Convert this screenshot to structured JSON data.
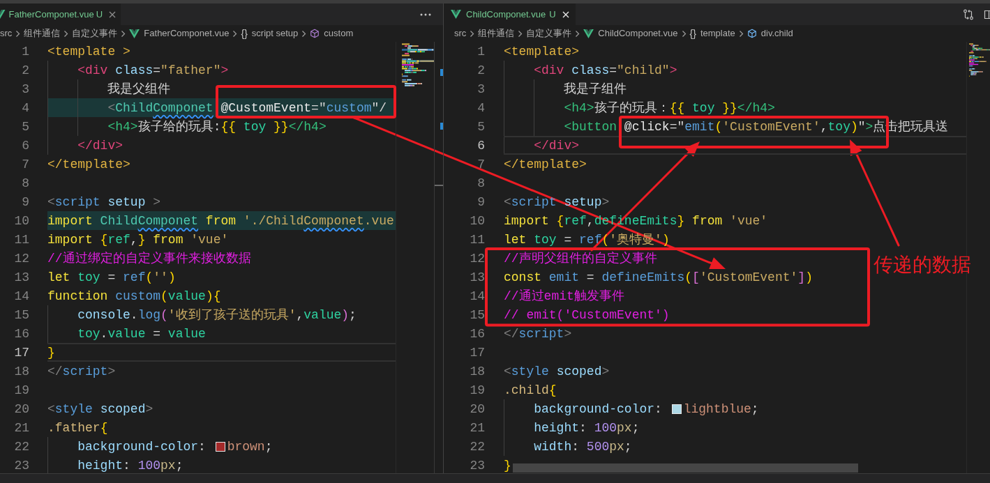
{
  "editors": [
    {
      "focused": false,
      "tab": {
        "label": "FatherComponet.vue",
        "badge": "U",
        "selected": true
      },
      "actions": [
        {
          "kind": "more"
        }
      ],
      "breadcrumb": [
        {
          "kind": "folder",
          "label": "src"
        },
        {
          "kind": "folder",
          "label": "组件通信"
        },
        {
          "kind": "folder",
          "label": "自定义事件"
        },
        {
          "kind": "file",
          "label": "FatherComponet.vue"
        },
        {
          "kind": "object",
          "glyph": "{}",
          "label": "script setup"
        },
        {
          "kind": "function",
          "label": "custom"
        }
      ],
      "lines": [
        {
          "number": "1",
          "current": false,
          "highlighted": false,
          "tokens": [
            {
              "text": "<template >",
              "kind": "tpl"
            }
          ]
        },
        {
          "number": "2",
          "current": false,
          "highlighted": false,
          "tokens": [
            {
              "text": "    <div",
              "kind": "tag"
            },
            {
              "text": " class",
              "kind": "attr"
            },
            {
              "text": "=",
              "kind": "op"
            },
            {
              "text": "\"father\"",
              "kind": "str"
            },
            {
              "text": ">",
              "kind": "tag"
            }
          ]
        },
        {
          "number": "3",
          "current": false,
          "highlighted": false,
          "tokens": [
            {
              "text": "        我是父组件",
              "kind": "txt"
            }
          ]
        },
        {
          "number": "4",
          "current": false,
          "highlighted": true,
          "tokens": [
            {
              "text": "        <",
              "kind": "gt"
            },
            {
              "text": "Child",
              "kind": "cls"
            },
            {
              "text": "Componet",
              "kind": "cls",
              "misspelled": true
            },
            {
              "text": " @CustomEvent",
              "kind": "at"
            },
            {
              "text": "=\"",
              "kind": "op"
            },
            {
              "text": "custom",
              "kind": "fn"
            },
            {
              "text": "\"/",
              "kind": "op"
            }
          ]
        },
        {
          "number": "5",
          "current": false,
          "highlighted": false,
          "tokens": [
            {
              "text": "        <h4>",
              "kind": "h4"
            },
            {
              "text": "孩子给的玩具:",
              "kind": "txt"
            },
            {
              "text": "{{",
              "kind": "b1"
            },
            {
              "text": " toy ",
              "kind": "var"
            },
            {
              "text": "}}",
              "kind": "b1"
            },
            {
              "text": "</h4>",
              "kind": "h4"
            }
          ]
        },
        {
          "number": "6",
          "current": false,
          "highlighted": false,
          "tokens": [
            {
              "text": "    </div>",
              "kind": "tag"
            }
          ]
        },
        {
          "number": "7",
          "current": false,
          "highlighted": false,
          "tokens": [
            {
              "text": "</template>",
              "kind": "tpl"
            }
          ]
        },
        {
          "number": "8",
          "current": false,
          "highlighted": false
        },
        {
          "number": "9",
          "current": false,
          "highlighted": false,
          "tokens": [
            {
              "text": "<",
              "kind": "gt"
            },
            {
              "text": "script",
              "kind": "fn"
            },
            {
              "text": " setup",
              "kind": "attr"
            },
            {
              "text": " >",
              "kind": "gt"
            }
          ]
        },
        {
          "number": "10",
          "current": false,
          "highlighted": true,
          "tokens": [
            {
              "text": "import",
              "kind": "kw"
            },
            {
              "text": " Child",
              "kind": "cls"
            },
            {
              "text": "Componet",
              "kind": "cls",
              "misspelled": true
            },
            {
              "text": " from",
              "kind": "kw"
            },
            {
              "text": " './Child",
              "kind": "str"
            },
            {
              "text": "Componet",
              "kind": "str",
              "misspelled": true
            },
            {
              "text": ".vue",
              "kind": "str"
            }
          ]
        },
        {
          "number": "11",
          "current": false,
          "highlighted": false,
          "tokens": [
            {
              "text": "import",
              "kind": "kw"
            },
            {
              "text": " {",
              "kind": "b1"
            },
            {
              "text": "ref",
              "kind": "var"
            },
            {
              "text": ",",
              "kind": "op"
            },
            {
              "text": "}",
              "kind": "b1"
            },
            {
              "text": " from",
              "kind": "kw"
            },
            {
              "text": " 'vue'",
              "kind": "str"
            }
          ]
        },
        {
          "number": "12",
          "current": false,
          "highlighted": false,
          "tokens": [
            {
              "text": "//通过绑定的自定义事件来接收数据",
              "kind": "cmt"
            }
          ]
        },
        {
          "number": "13",
          "current": false,
          "highlighted": false,
          "tokens": [
            {
              "text": "let",
              "kind": "kw"
            },
            {
              "text": " toy",
              "kind": "var"
            },
            {
              "text": " =",
              "kind": "op"
            },
            {
              "text": " ref",
              "kind": "fn"
            },
            {
              "text": "(",
              "kind": "b1"
            },
            {
              "text": "''",
              "kind": "str"
            },
            {
              "text": ")",
              "kind": "b1"
            }
          ]
        },
        {
          "number": "14",
          "current": false,
          "highlighted": false,
          "tokens": [
            {
              "text": "function",
              "kind": "kw"
            },
            {
              "text": " custom",
              "kind": "fn"
            },
            {
              "text": "(",
              "kind": "b1"
            },
            {
              "text": "value",
              "kind": "var"
            },
            {
              "text": ")",
              "kind": "b1"
            },
            {
              "text": "{",
              "kind": "b1"
            }
          ]
        },
        {
          "number": "15",
          "current": false,
          "highlighted": false,
          "tokens": [
            {
              "text": "    console",
              "kind": "attr"
            },
            {
              "text": ".",
              "kind": "op"
            },
            {
              "text": "log",
              "kind": "fn"
            },
            {
              "text": "(",
              "kind": "b2"
            },
            {
              "text": "'收到了孩子送的玩具'",
              "kind": "str"
            },
            {
              "text": ",",
              "kind": "op"
            },
            {
              "text": "value",
              "kind": "var"
            },
            {
              "text": ")",
              "kind": "b2"
            },
            {
              "text": ";",
              "kind": "op"
            }
          ]
        },
        {
          "number": "16",
          "current": false,
          "highlighted": false,
          "tokens": [
            {
              "text": "    toy",
              "kind": "var"
            },
            {
              "text": ".",
              "kind": "op"
            },
            {
              "text": "value",
              "kind": "var"
            },
            {
              "text": " =",
              "kind": "op"
            },
            {
              "text": " value",
              "kind": "var"
            }
          ]
        },
        {
          "number": "17",
          "current": true,
          "highlighted": false,
          "tokens": [
            {
              "text": "}",
              "kind": "b1"
            }
          ]
        },
        {
          "number": "18",
          "current": false,
          "highlighted": false,
          "tokens": [
            {
              "text": "</",
              "kind": "gt"
            },
            {
              "text": "script",
              "kind": "fn"
            },
            {
              "text": ">",
              "kind": "gt"
            }
          ]
        },
        {
          "number": "19",
          "current": false,
          "highlighted": false
        },
        {
          "number": "20",
          "current": false,
          "highlighted": false,
          "tokens": [
            {
              "text": "<",
              "kind": "gt"
            },
            {
              "text": "style",
              "kind": "fn"
            },
            {
              "text": " scoped",
              "kind": "attr"
            },
            {
              "text": ">",
              "kind": "gt"
            }
          ]
        },
        {
          "number": "21",
          "current": false,
          "highlighted": false,
          "tokens": [
            {
              "text": ".father",
              "kind": "sel"
            },
            {
              "text": "{",
              "kind": "b1"
            }
          ]
        },
        {
          "number": "22",
          "current": false,
          "highlighted": false,
          "tokens": [
            {
              "text": "    background-color",
              "kind": "attr"
            },
            {
              "text": ": ",
              "kind": "op"
            },
            {
              "kind": "swatch",
              "color": "#a52a2a"
            },
            {
              "text": "brown",
              "kind": "val"
            },
            {
              "text": ";",
              "kind": "op"
            }
          ]
        },
        {
          "number": "23",
          "current": false,
          "highlighted": false,
          "tokens": [
            {
              "text": "    height",
              "kind": "attr"
            },
            {
              "text": ": ",
              "kind": "op"
            },
            {
              "text": "100",
              "kind": "num"
            },
            {
              "text": "px",
              "kind": "unit"
            },
            {
              "text": ";",
              "kind": "op"
            }
          ]
        }
      ]
    },
    {
      "focused": true,
      "tab": {
        "label": "ChildComponet.vue",
        "badge": "U",
        "selected": true
      },
      "actions": [
        {
          "kind": "compare"
        },
        {
          "kind": "split"
        }
      ],
      "breadcrumb": [
        {
          "kind": "folder",
          "label": "src"
        },
        {
          "kind": "folder",
          "label": "组件通信"
        },
        {
          "kind": "folder",
          "label": "自定义事件"
        },
        {
          "kind": "file",
          "label": "ChildComponet.vue"
        },
        {
          "kind": "object",
          "glyph": "{}",
          "label": "template"
        },
        {
          "kind": "element",
          "label": "div.child"
        }
      ],
      "lines": [
        {
          "number": "1",
          "current": false,
          "highlighted": false,
          "tokens": [
            {
              "text": "<template>",
              "kind": "tpl"
            }
          ]
        },
        {
          "number": "2",
          "current": false,
          "highlighted": false,
          "tokens": [
            {
              "text": "    <div",
              "kind": "tag"
            },
            {
              "text": " class",
              "kind": "attr"
            },
            {
              "text": "=",
              "kind": "op"
            },
            {
              "text": "\"child\"",
              "kind": "str"
            },
            {
              "text": ">",
              "kind": "tag"
            }
          ]
        },
        {
          "number": "3",
          "current": false,
          "highlighted": false,
          "tokens": [
            {
              "text": "        我是子组件",
              "kind": "txt"
            }
          ]
        },
        {
          "number": "4",
          "current": false,
          "highlighted": false,
          "tokens": [
            {
              "text": "        <h4>",
              "kind": "h4"
            },
            {
              "text": "孩子的玩具：",
              "kind": "txt"
            },
            {
              "text": "{{",
              "kind": "b1"
            },
            {
              "text": " toy ",
              "kind": "var"
            },
            {
              "text": "}}",
              "kind": "b1"
            },
            {
              "text": "</h4>",
              "kind": "h4"
            }
          ]
        },
        {
          "number": "5",
          "current": false,
          "highlighted": false,
          "tokens": [
            {
              "text": "        <button",
              "kind": "h4"
            },
            {
              "text": " @click",
              "kind": "at"
            },
            {
              "text": "=\"",
              "kind": "op"
            },
            {
              "text": "emit",
              "kind": "fn"
            },
            {
              "text": "(",
              "kind": "b1"
            },
            {
              "text": "'CustomEvent'",
              "kind": "str"
            },
            {
              "text": ",",
              "kind": "op"
            },
            {
              "text": "toy",
              "kind": "var"
            },
            {
              "text": ")",
              "kind": "b1"
            },
            {
              "text": "\"",
              "kind": "op"
            },
            {
              "text": ">",
              "kind": "h4"
            },
            {
              "text": "点击把玩具送",
              "kind": "txt"
            }
          ]
        },
        {
          "number": "6",
          "current": true,
          "highlighted": false,
          "tokens": [
            {
              "text": "    </div>",
              "kind": "tag"
            }
          ]
        },
        {
          "number": "7",
          "current": false,
          "highlighted": false,
          "tokens": [
            {
              "text": "</template>",
              "kind": "tpl"
            }
          ]
        },
        {
          "number": "8",
          "current": false,
          "highlighted": false
        },
        {
          "number": "9",
          "current": false,
          "highlighted": false,
          "tokens": [
            {
              "text": "<",
              "kind": "gt"
            },
            {
              "text": "script",
              "kind": "fn"
            },
            {
              "text": " setup",
              "kind": "attr"
            },
            {
              "text": ">",
              "kind": "gt"
            }
          ]
        },
        {
          "number": "10",
          "current": false,
          "highlighted": false,
          "tokens": [
            {
              "text": "import",
              "kind": "kw"
            },
            {
              "text": " {",
              "kind": "b1"
            },
            {
              "text": "ref",
              "kind": "var"
            },
            {
              "text": ",",
              "kind": "op"
            },
            {
              "text": "defineEmits",
              "kind": "var"
            },
            {
              "text": "}",
              "kind": "b1"
            },
            {
              "text": " from",
              "kind": "kw"
            },
            {
              "text": " 'vue'",
              "kind": "str"
            }
          ]
        },
        {
          "number": "11",
          "current": false,
          "highlighted": false,
          "tokens": [
            {
              "text": "let",
              "kind": "kw"
            },
            {
              "text": " toy",
              "kind": "var"
            },
            {
              "text": " =",
              "kind": "op"
            },
            {
              "text": " ref",
              "kind": "fn"
            },
            {
              "text": "(",
              "kind": "b1"
            },
            {
              "text": "'奥特曼'",
              "kind": "str"
            },
            {
              "text": ")",
              "kind": "b1"
            }
          ]
        },
        {
          "number": "12",
          "current": false,
          "highlighted": false,
          "tokens": [
            {
              "text": "//声明父组件的自定义事件",
              "kind": "cmt"
            }
          ]
        },
        {
          "number": "13",
          "current": false,
          "highlighted": false,
          "tokens": [
            {
              "text": "const",
              "kind": "kw"
            },
            {
              "text": " emit",
              "kind": "fn"
            },
            {
              "text": " =",
              "kind": "op"
            },
            {
              "text": " defineEmits",
              "kind": "fn"
            },
            {
              "text": "(",
              "kind": "b1"
            },
            {
              "text": "[",
              "kind": "b2"
            },
            {
              "text": "'CustomEvent'",
              "kind": "str"
            },
            {
              "text": "]",
              "kind": "b2"
            },
            {
              "text": ")",
              "kind": "b1"
            }
          ]
        },
        {
          "number": "14",
          "current": false,
          "highlighted": false,
          "tokens": [
            {
              "text": "//通过emit触发事件",
              "kind": "cmt"
            }
          ]
        },
        {
          "number": "15",
          "current": false,
          "highlighted": false,
          "tokens": [
            {
              "text": "// emit('CustomEvent')",
              "kind": "cmt"
            }
          ]
        },
        {
          "number": "16",
          "current": false,
          "highlighted": false,
          "tokens": [
            {
              "text": "</",
              "kind": "gt"
            },
            {
              "text": "script",
              "kind": "fn"
            },
            {
              "text": ">",
              "kind": "gt"
            }
          ]
        },
        {
          "number": "17",
          "current": false,
          "highlighted": false
        },
        {
          "number": "18",
          "current": false,
          "highlighted": false,
          "tokens": [
            {
              "text": "<",
              "kind": "gt"
            },
            {
              "text": "style",
              "kind": "fn"
            },
            {
              "text": " scoped",
              "kind": "attr"
            },
            {
              "text": ">",
              "kind": "gt"
            }
          ]
        },
        {
          "number": "19",
          "current": false,
          "highlighted": false,
          "tokens": [
            {
              "text": ".child",
              "kind": "sel"
            },
            {
              "text": "{",
              "kind": "b1"
            }
          ]
        },
        {
          "number": "20",
          "current": false,
          "highlighted": false,
          "tokens": [
            {
              "text": "    background-color",
              "kind": "attr"
            },
            {
              "text": ": ",
              "kind": "op"
            },
            {
              "kind": "swatch",
              "color": "#add8e6"
            },
            {
              "text": "lightblue",
              "kind": "val"
            },
            {
              "text": ";",
              "kind": "op"
            }
          ]
        },
        {
          "number": "21",
          "current": false,
          "highlighted": false,
          "tokens": [
            {
              "text": "    height",
              "kind": "attr"
            },
            {
              "text": ": ",
              "kind": "op"
            },
            {
              "text": "100",
              "kind": "num"
            },
            {
              "text": "px",
              "kind": "unit"
            },
            {
              "text": ";",
              "kind": "op"
            }
          ]
        },
        {
          "number": "22",
          "current": false,
          "highlighted": false,
          "tokens": [
            {
              "text": "    width",
              "kind": "attr"
            },
            {
              "text": ": ",
              "kind": "op"
            },
            {
              "text": "500",
              "kind": "num"
            },
            {
              "text": "px",
              "kind": "unit"
            },
            {
              "text": ";",
              "kind": "op"
            }
          ]
        },
        {
          "number": "23",
          "current": false,
          "highlighted": false,
          "tokens": [
            {
              "text": "}",
              "kind": "b1"
            }
          ]
        }
      ]
    }
  ],
  "annotations": {
    "label": "传递的数据"
  }
}
